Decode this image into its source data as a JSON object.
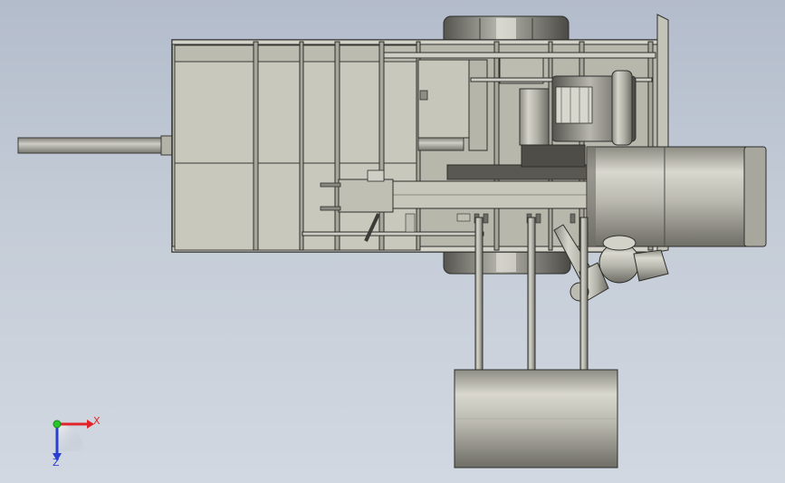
{
  "viewport": {
    "background_top": "#b3bccb",
    "background_bottom": "#d2d8e1"
  },
  "triad": {
    "x_label": "X",
    "z_label": "Z",
    "x_color": "#e0242a",
    "y_color": "#27c42a",
    "z_color": "#2a3fcf"
  },
  "colors": {
    "panel": "#c9c8bc",
    "panel_dark": "#a9a89c",
    "frame": "#5c5c56",
    "edge": "#2e2e2b"
  }
}
